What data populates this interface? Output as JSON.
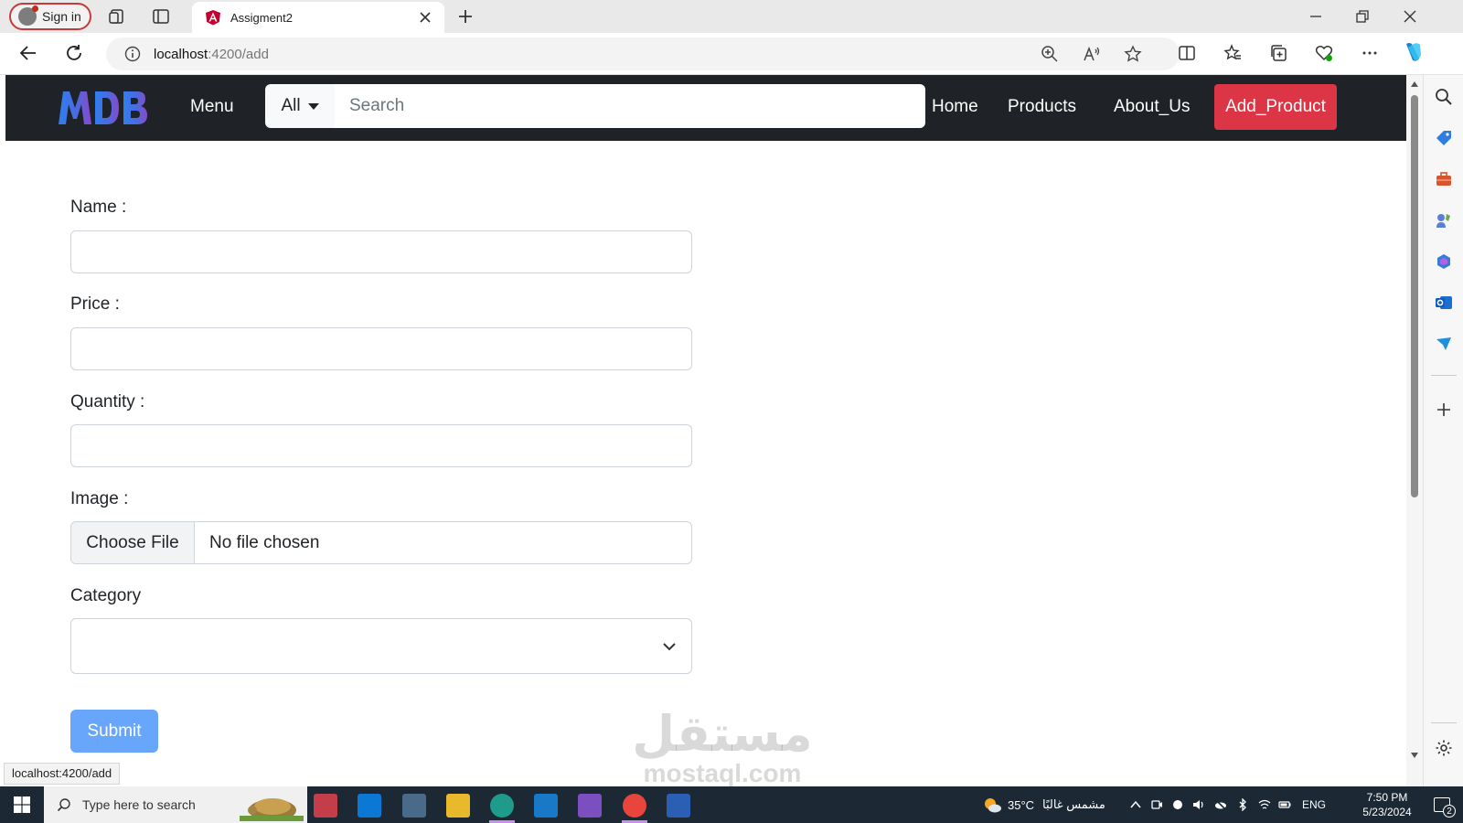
{
  "browser": {
    "signin_label": "Sign in",
    "tab_title": "Assigment2",
    "url_host": "localhost",
    "url_path": ":4200/add",
    "status_url": "localhost:4200/add"
  },
  "navbar": {
    "logo_text": "MDB",
    "menu_label": "Menu",
    "category_label": "All",
    "search_placeholder": "Search",
    "links": [
      "Home",
      "Products",
      "About_Us"
    ],
    "add_product_label": "Add_Product",
    "colors": {
      "background": "#1f2327",
      "add_button": "#dc3545"
    }
  },
  "form": {
    "name_label": "Name :",
    "price_label": "Price :",
    "quantity_label": "Quantity :",
    "image_label": "Image :",
    "choose_file_label": "Choose File",
    "file_status": "No file chosen",
    "category_label": "Category",
    "category_value": "",
    "submit_label": "Submit",
    "colors": {
      "submit": "#67a6fb"
    }
  },
  "taskbar": {
    "search_placeholder": "Type here to search",
    "weather_temp": "35°C",
    "weather_desc": "مشمس غالبًا",
    "language": "ENG",
    "time": "7:50 PM",
    "date": "5/23/2024",
    "notification_count": "2"
  },
  "watermark": {
    "text_ar": "مستقل",
    "text_en": "mostaql.com"
  }
}
